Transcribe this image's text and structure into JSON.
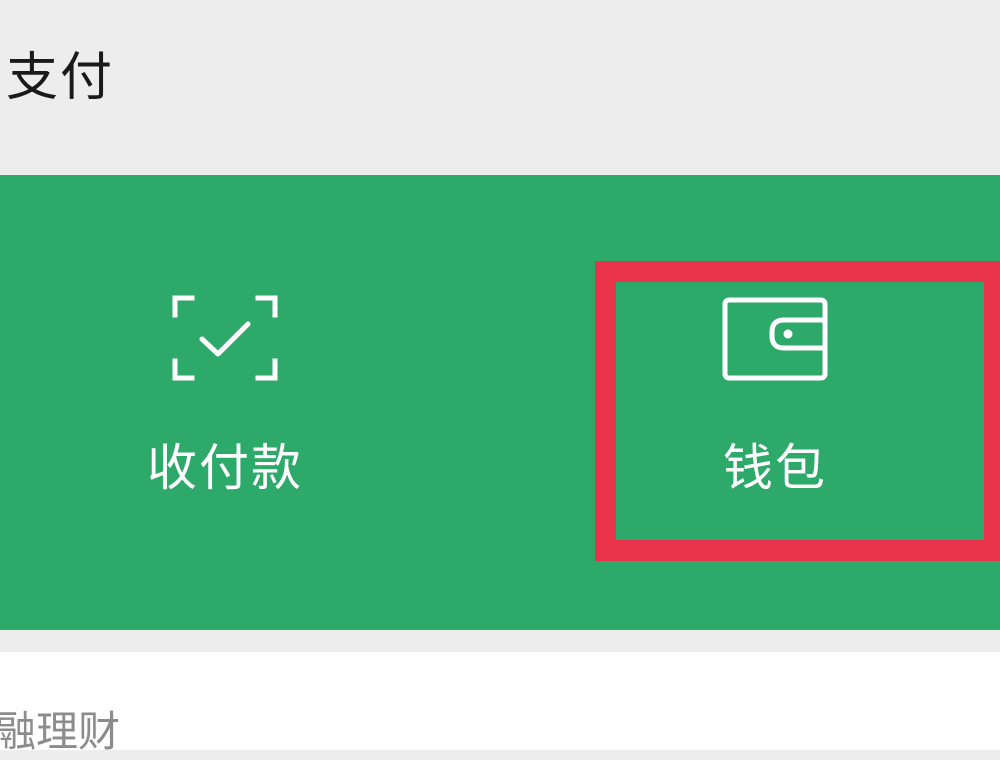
{
  "header": {
    "title": "支付"
  },
  "pay_panel": {
    "background_color": "#2daa6a",
    "items": [
      {
        "label": "收付款",
        "icon": "scan-check-icon"
      },
      {
        "label": "钱包",
        "icon": "wallet-icon"
      }
    ]
  },
  "highlight": {
    "color": "#e8334a",
    "target": "钱包"
  },
  "section": {
    "title": "融理财"
  }
}
